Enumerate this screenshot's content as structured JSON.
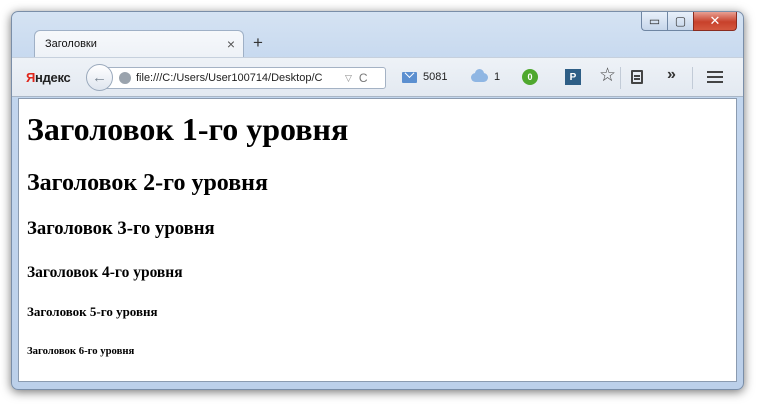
{
  "tab": {
    "title": "Заголовки",
    "close_glyph": "×",
    "new_tab_glyph": "+"
  },
  "window_controls": {
    "minimize": "▭",
    "maximize": "▢",
    "close": "✕"
  },
  "toolbar": {
    "brand": {
      "first_letter": "Я",
      "rest": "ндекс"
    },
    "back_glyph": "←",
    "url": "file:///C:/Users/User100714/Desktop/C",
    "url_dropdown_glyph": "▽",
    "reload_glyph": "C",
    "mail_count": "5081",
    "cloud_count": "1",
    "badge_value": "0",
    "p_label": "P",
    "star_glyph": "☆",
    "more_glyph": "»",
    "icons": [
      "back-icon",
      "globe-icon",
      "mail-icon",
      "cloud-icon",
      "badge-icon",
      "p-icon",
      "star-icon",
      "reader-icon",
      "more-icon",
      "menu-icon"
    ]
  },
  "page": {
    "h1": "Заголовок 1-го уровня",
    "h2": "Заголовок 2-го уровня",
    "h3": "Заголовок 3-го уровня",
    "h4": "Заголовок 4-го уровня",
    "h5": "Заголовок 5-го уровня",
    "h6": "Заголовок 6-го уровня"
  },
  "colors": {
    "window_frame": "#c3d6ee",
    "close_button": "#c8412b",
    "brand_accent": "#e0261b",
    "badge_green": "#4fa82e",
    "p_icon_blue": "#2e5e86",
    "mail_blue": "#5b8fd0"
  }
}
